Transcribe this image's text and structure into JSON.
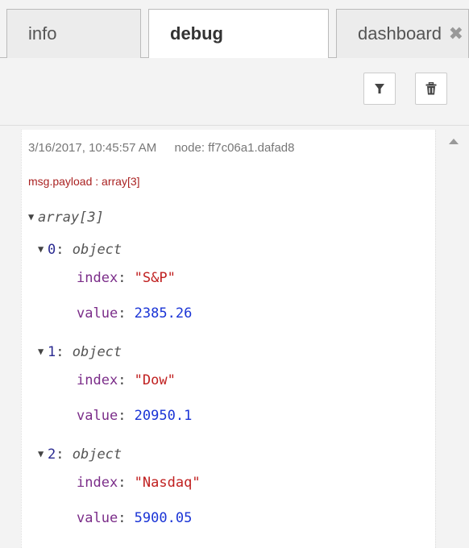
{
  "tabs": [
    {
      "label": "info",
      "active": false
    },
    {
      "label": "debug",
      "active": true
    },
    {
      "label": "dashboard",
      "active": false
    }
  ],
  "tab_close_glyph": "✖",
  "toolbar": {
    "filter_icon": "filter-icon",
    "clear_icon": "trash-icon"
  },
  "message": {
    "timestamp": "3/16/2017, 10:45:57 AM",
    "node": "node: ff7c06a1.dafad8",
    "topic": "msg.payload : array[3]",
    "tree": {
      "root_type": "array[3]",
      "items": [
        {
          "index": "0",
          "type": "object",
          "fields": [
            {
              "key": "index",
              "value": "\"S&P\""
            },
            {
              "key": "value",
              "value": "2385.26"
            }
          ]
        },
        {
          "index": "1",
          "type": "object",
          "fields": [
            {
              "key": "index",
              "value": "\"Dow\""
            },
            {
              "key": "value",
              "value": "20950.1"
            }
          ]
        },
        {
          "index": "2",
          "type": "object",
          "fields": [
            {
              "key": "index",
              "value": "\"Nasdaq\""
            },
            {
              "key": "value",
              "value": "5900.05"
            }
          ]
        }
      ]
    }
  },
  "colors": {
    "string": "#c02020",
    "number": "#1a34d6",
    "key": "#7b2d89",
    "topic": "#aa2222"
  }
}
